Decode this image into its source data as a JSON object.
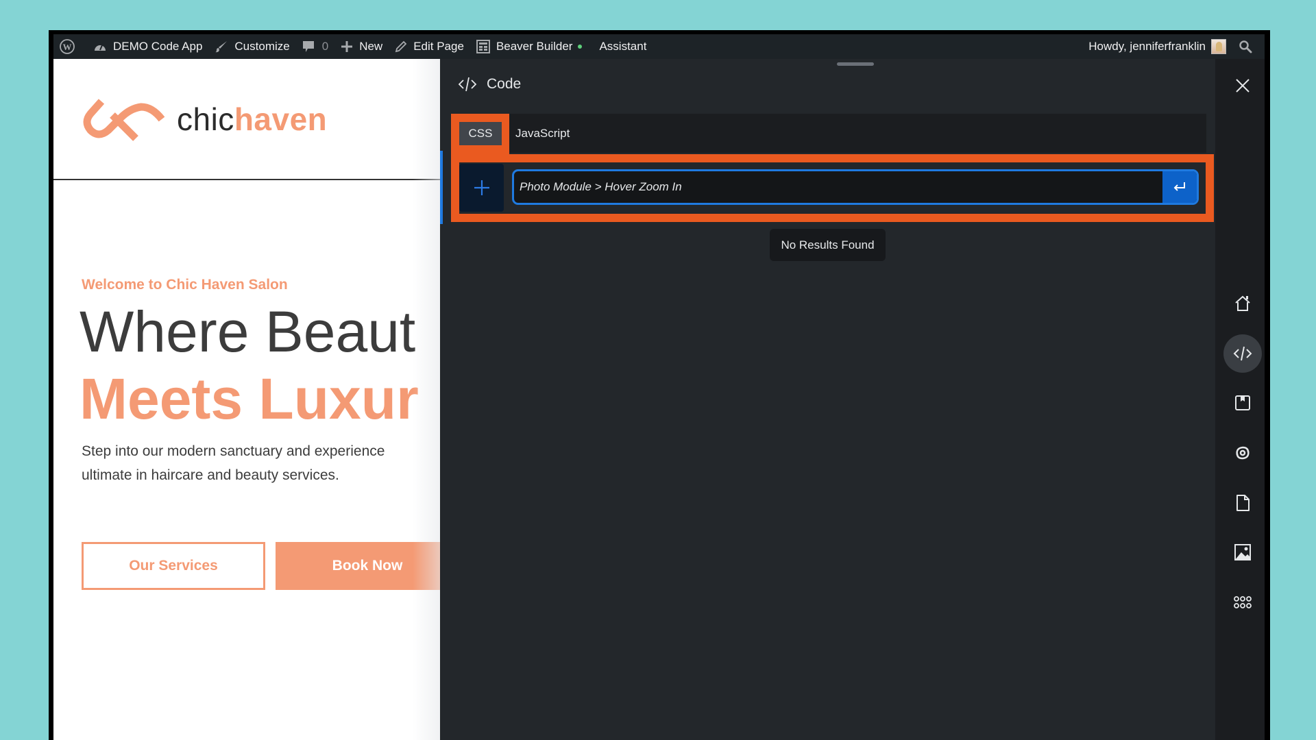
{
  "adminbar": {
    "site_name": "DEMO Code App",
    "customize": "Customize",
    "comments_count": "0",
    "new": "New",
    "edit_page": "Edit Page",
    "beaver_builder": "Beaver Builder",
    "assistant": "Assistant",
    "greeting": "Howdy, jenniferfranklin",
    "status_dot_color": "#5ed07b"
  },
  "page": {
    "logo_part1": "chic",
    "logo_part2": "haven",
    "eyebrow": "Welcome to Chic Haven Salon",
    "headline_line1": "Where Beaut",
    "headline_line2": "Meets Luxur",
    "lead_line1": "Step into our modern sanctuary and experience",
    "lead_line2": "ultimate in haircare and beauty services.",
    "btn_services": "Our Services",
    "btn_book": "Book Now",
    "accent_color": "#f49a74"
  },
  "panel": {
    "title": "Code",
    "tabs": [
      {
        "label": "CSS",
        "active": true
      },
      {
        "label": "JavaScript",
        "active": false
      }
    ],
    "search": {
      "value": "Photo Module > Hover Zoom In",
      "placeholder": ""
    },
    "no_results": "No Results Found",
    "highlight_color": "#ea5a20"
  },
  "sidebar": {
    "items": [
      {
        "icon": "home-icon",
        "active": false
      },
      {
        "icon": "code-icon",
        "active": true
      },
      {
        "icon": "save-icon",
        "active": false
      },
      {
        "icon": "swirl-icon",
        "active": false
      },
      {
        "icon": "file-icon",
        "active": false
      },
      {
        "icon": "image-icon",
        "active": false
      },
      {
        "icon": "apps-grid-icon",
        "active": false
      }
    ]
  }
}
